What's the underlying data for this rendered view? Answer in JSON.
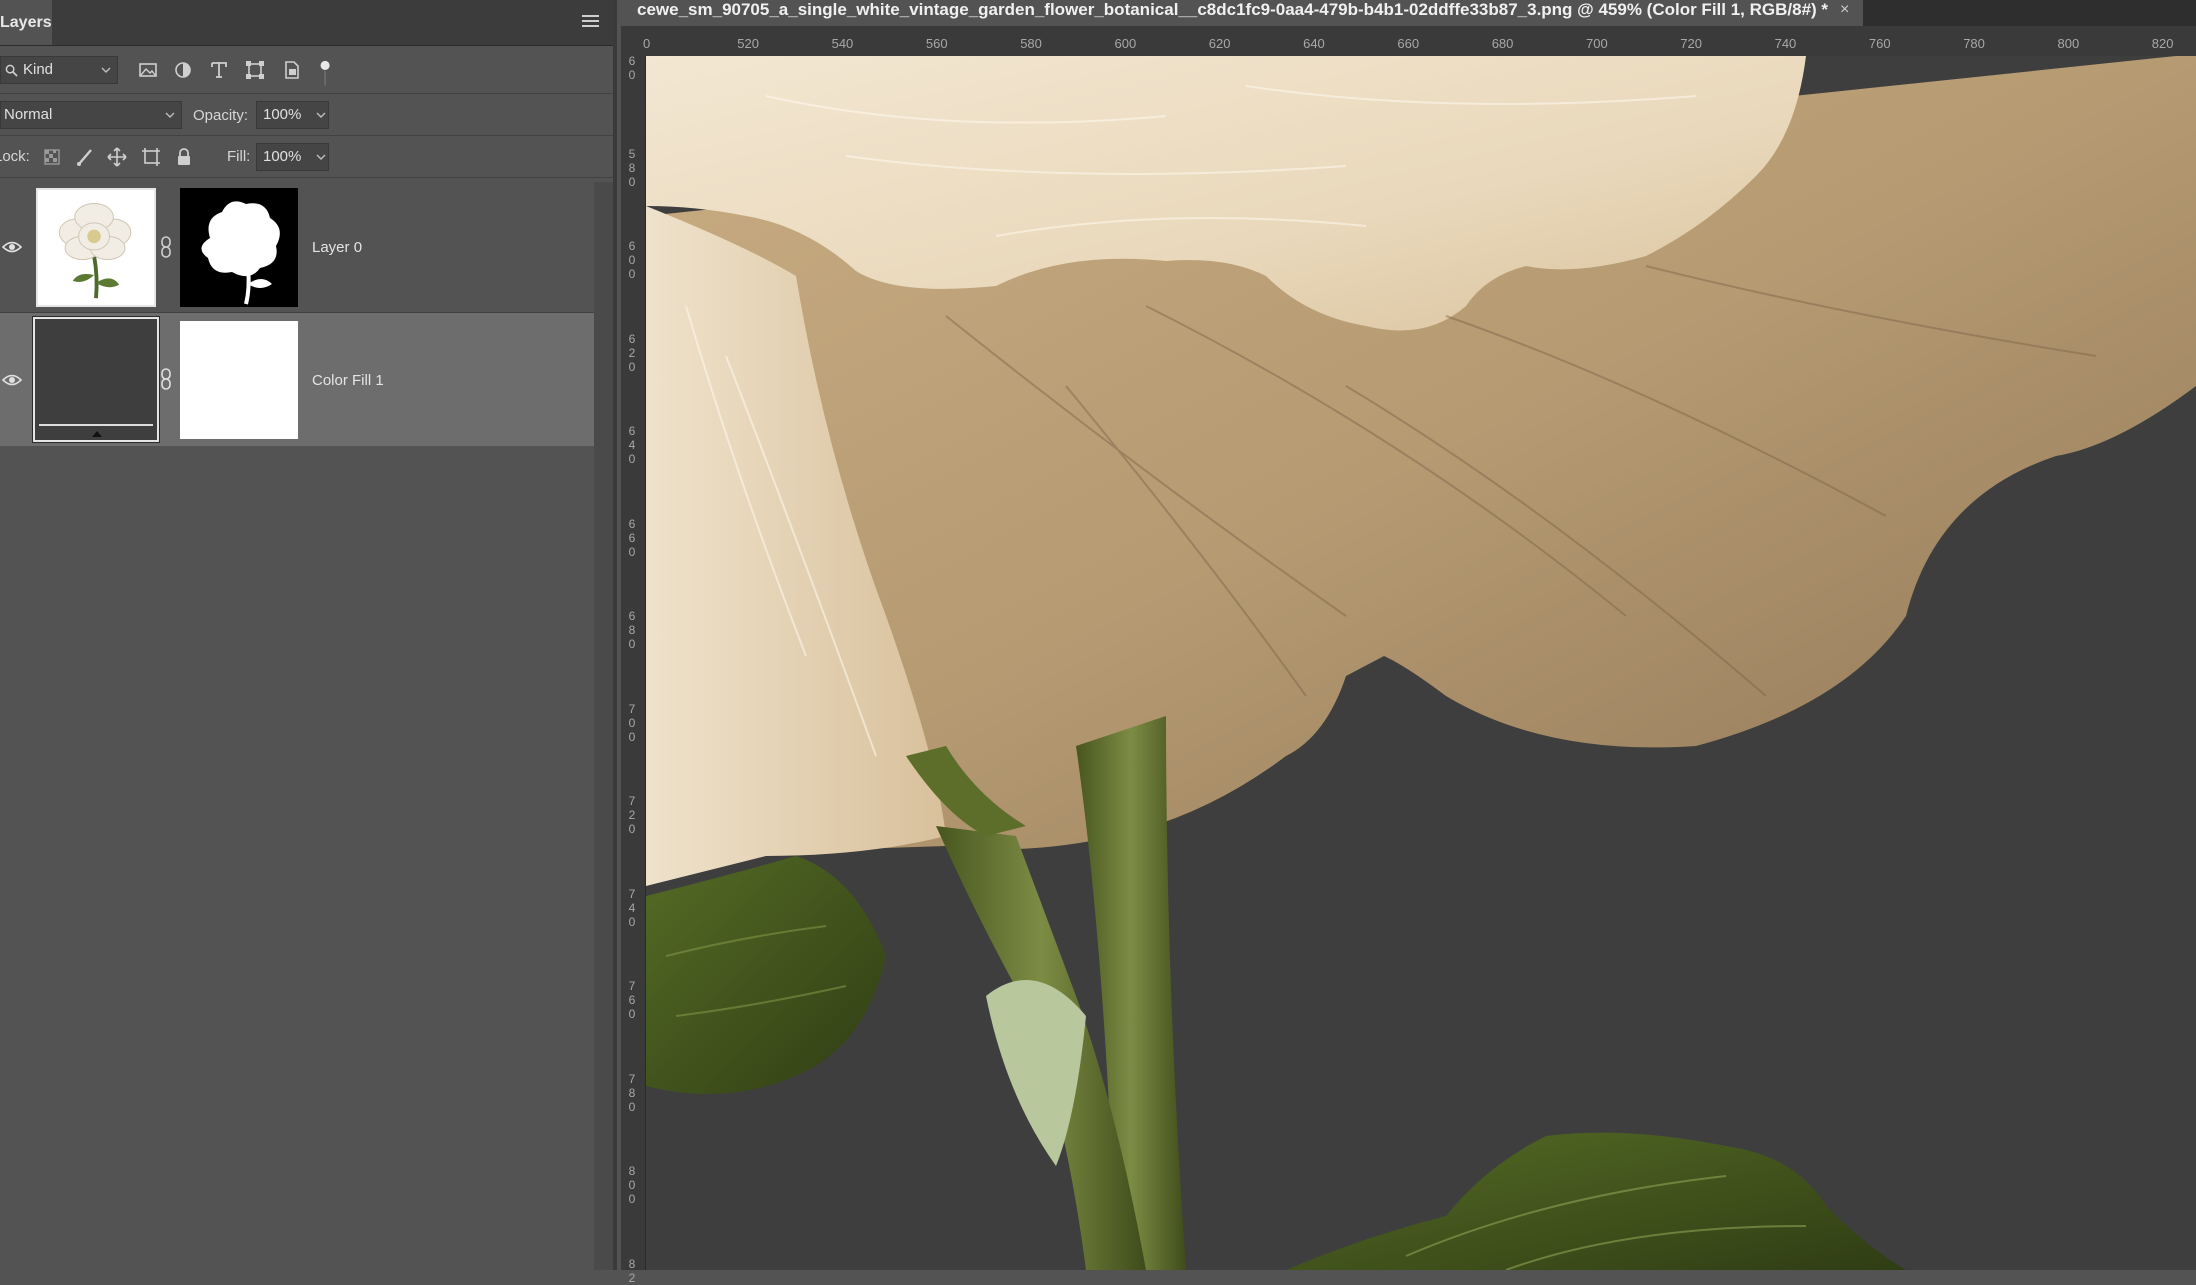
{
  "panel": {
    "tab_label": "Layers",
    "filter": {
      "kind_label": "Kind"
    },
    "blend_mode": "Normal",
    "opacity_label": "Opacity:",
    "opacity_value": "100%",
    "lock_label": "Lock:",
    "fill_label": "Fill:",
    "fill_value": "100%",
    "layers": [
      {
        "name": "Layer 0",
        "visible": true,
        "selected": false
      },
      {
        "name": "Color Fill 1",
        "visible": true,
        "selected": true
      }
    ]
  },
  "document": {
    "tab_title": "cewe_sm_90705_a_single_white_vintage_garden_flower_botanical__c8dc1fc9-0aa4-479b-b4b1-02ddffe33b87_3.png @ 459% (Color Fill 1, RGB/8#) *",
    "close_glyph": "×",
    "h_ruler_labels": [
      "0",
      "520",
      "540",
      "560",
      "580",
      "600",
      "620",
      "640",
      "660",
      "680",
      "700",
      "720",
      "740",
      "760",
      "780",
      "800",
      "820"
    ],
    "v_ruler_labels": [
      "60",
      "580",
      "600",
      "620",
      "640",
      "660",
      "680",
      "700",
      "720",
      "740",
      "760",
      "780",
      "800",
      "82"
    ]
  },
  "colors": {
    "panel_bg": "#535353",
    "selected_layer_bg": "#6d6d6d",
    "canvas_bg": "#3e3e3e",
    "petal_light": "#efe3cd",
    "petal_shadow": "#a8906b",
    "stem_green": "#5f7030"
  },
  "icons": [
    "search-icon",
    "image-filter-icon",
    "adjustment-filter-icon",
    "type-filter-icon",
    "shape-filter-icon",
    "smart-object-filter-icon",
    "filter-toggle-icon",
    "panel-menu-icon",
    "lock-pixels-icon",
    "lock-image-icon",
    "lock-position-icon",
    "lock-artboard-icon",
    "lock-all-icon",
    "eye-icon",
    "link-icon"
  ]
}
